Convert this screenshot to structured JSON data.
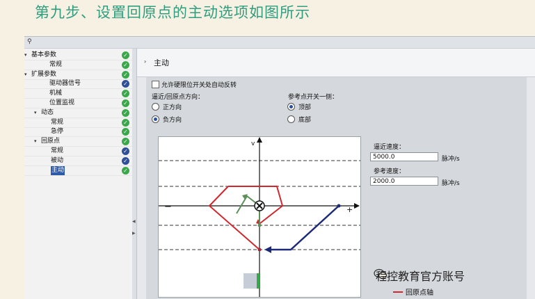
{
  "slide_title": "第九步、设置回原点的主动选项如图所示",
  "toolbar": {
    "icon": "options-icon"
  },
  "tree": {
    "items": [
      {
        "label": "基本参数",
        "level": 0,
        "expanded": true,
        "status": "green"
      },
      {
        "label": "常规",
        "level": 1,
        "status": "green"
      },
      {
        "label": "扩展参数",
        "level": 0,
        "expanded": true,
        "status": "green"
      },
      {
        "label": "驱动器信号",
        "level": 1,
        "status": "blue"
      },
      {
        "label": "机械",
        "level": 1,
        "status": "green"
      },
      {
        "label": "位置监视",
        "level": 1,
        "status": "green"
      },
      {
        "label": "动态",
        "level": 1,
        "expanded": true,
        "status": "green"
      },
      {
        "label": "常规",
        "level": 2,
        "status": "green"
      },
      {
        "label": "急停",
        "level": 2,
        "status": "green"
      },
      {
        "label": "回原点",
        "level": 1,
        "expanded": true,
        "status": "green"
      },
      {
        "label": "常规",
        "level": 2,
        "status": "blue"
      },
      {
        "label": "被动",
        "level": 2,
        "status": "blue"
      },
      {
        "label": "主动",
        "level": 2,
        "status": "green",
        "selected": true
      }
    ]
  },
  "section": {
    "title": "主动"
  },
  "form": {
    "auto_reverse": {
      "label": "允许硬限位开关处自动反转",
      "checked": false
    },
    "approach_dir": {
      "label": "逼近/回原点方向：",
      "options": [
        {
          "label": "正方向",
          "selected": false
        },
        {
          "label": "负方向",
          "selected": true
        }
      ]
    },
    "ref_side": {
      "label": "参考点开关一侧：",
      "options": [
        {
          "label": "顶部",
          "selected": true
        },
        {
          "label": "底部",
          "selected": false
        }
      ]
    },
    "approach_speed": {
      "label": "逼近速度：",
      "value": "5000.0",
      "unit": "脉冲/s"
    },
    "ref_speed": {
      "label": "参考速度：",
      "value": "2000.0",
      "unit": "脉冲/s"
    }
  },
  "diagram": {
    "axis_v": "v",
    "axis_s": "s",
    "minus": "−",
    "plus": "+",
    "colors": {
      "approach": "#1c2a78",
      "reference": "#d0282e",
      "home": "#5d8f5a"
    }
  },
  "watermark": "程控教育官方账号",
  "legend": {
    "label": "回原点轴"
  }
}
